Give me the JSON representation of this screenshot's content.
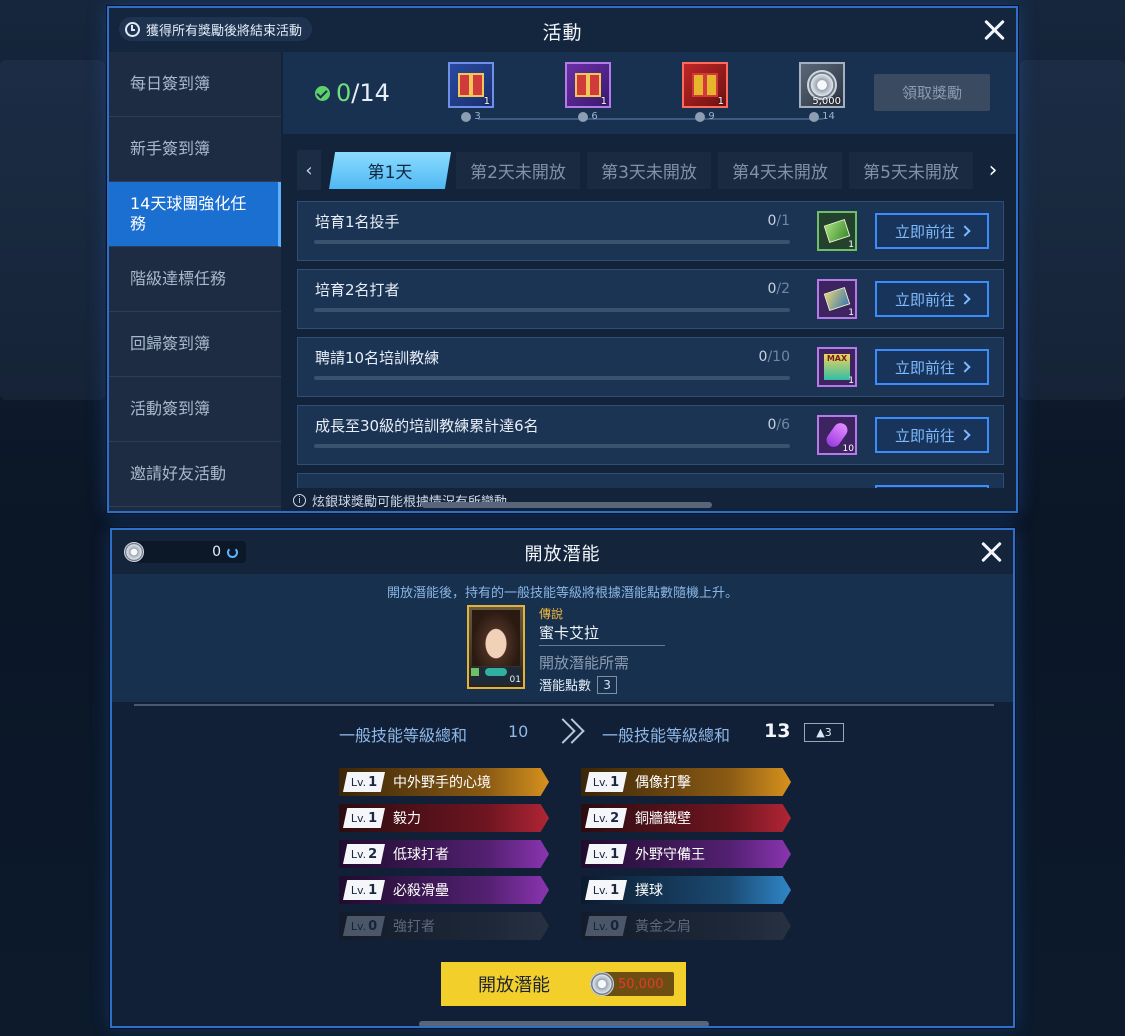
{
  "activity": {
    "notice": "獲得所有獎勵後將結束活動",
    "title": "活動",
    "sidebar": [
      {
        "label": "每日簽到簿",
        "active": false
      },
      {
        "label": "新手簽到簿",
        "active": false
      },
      {
        "label": "14天球團強化任務",
        "active": true
      },
      {
        "label": "階級達標任務",
        "active": false
      },
      {
        "label": "回歸簽到簿",
        "active": false
      },
      {
        "label": "活動簽到簿",
        "active": false
      },
      {
        "label": "邀請好友活動",
        "active": false
      }
    ],
    "progress": {
      "done": "0",
      "total": "/14"
    },
    "milestones": [
      {
        "icon": "gift-box-icon",
        "qty": "1",
        "label": "3"
      },
      {
        "icon": "gift-box-icon",
        "qty": "1",
        "label": "6"
      },
      {
        "icon": "gift-box-icon",
        "qty": "1",
        "label": "9"
      },
      {
        "icon": "silver-coin-icon",
        "qty": "5,000",
        "label": "14"
      }
    ],
    "claim_label": "領取獎勵",
    "tabs": [
      "第1天",
      "第2天未開放",
      "第3天未開放",
      "第4天未開放",
      "第5天未開放"
    ],
    "tasks": [
      {
        "name": "培育1名投手",
        "current": "0",
        "target": "/1",
        "reward_qty": "1",
        "button": "立即前往"
      },
      {
        "name": "培育2名打者",
        "current": "0",
        "target": "/2",
        "reward_qty": "1",
        "button": "立即前往"
      },
      {
        "name": "聘請10名培訓教練",
        "current": "0",
        "target": "/10",
        "reward_qty": "1",
        "button": "立即前往"
      },
      {
        "name": "成長至30級的培訓教練累計達6名",
        "current": "0",
        "target": "/6",
        "reward_qty": "10",
        "button": "立即前往"
      }
    ],
    "footer_note": "炫銀球獎勵可能根據情況有所變動。"
  },
  "potential": {
    "coin_balance": "0",
    "title": "開放潛能",
    "description": "開放潛能後，持有的一般技能等級將根據潛能點數隨機上升。",
    "player": {
      "rarity": "傳說",
      "name": "蜜卡艾拉",
      "card_level": "01"
    },
    "requirement_label": "開放潛能所需",
    "points_label": "潛能點數",
    "points_value": "3",
    "sum_label": "一般技能等級總和",
    "sum_before": "10",
    "sum_after": "13",
    "sum_delta": "▲3",
    "skills_left": [
      {
        "lv": "1",
        "name": "中外野手的心境",
        "tier": "gold"
      },
      {
        "lv": "1",
        "name": "毅力",
        "tier": "red"
      },
      {
        "lv": "2",
        "name": "低球打者",
        "tier": "purple"
      },
      {
        "lv": "1",
        "name": "必殺滑壘",
        "tier": "purple"
      },
      {
        "lv": "0",
        "name": "強打者",
        "tier": "gray"
      }
    ],
    "skills_right": [
      {
        "lv": "1",
        "name": "偶像打擊",
        "tier": "gold"
      },
      {
        "lv": "2",
        "name": "銅牆鐵壁",
        "tier": "red"
      },
      {
        "lv": "1",
        "name": "外野守備王",
        "tier": "purple"
      },
      {
        "lv": "1",
        "name": "撲球",
        "tier": "blue"
      },
      {
        "lv": "0",
        "name": "黃金之肩",
        "tier": "gray"
      }
    ],
    "lv_prefix": "Lv.",
    "open_button": "開放潛能",
    "cost": "50,000"
  }
}
